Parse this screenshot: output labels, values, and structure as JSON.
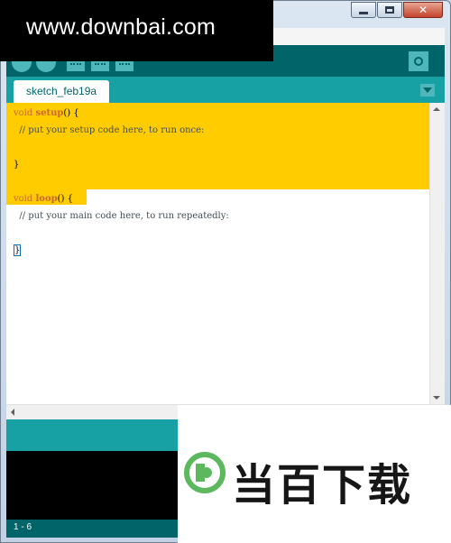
{
  "watermark": {
    "url_text": "www.downbai.com",
    "logo_text": "当百下载"
  },
  "tabs": [
    {
      "label": "sketch_feb19a"
    }
  ],
  "editor": {
    "setup_keyword": "void",
    "setup_name": "setup",
    "setup_parens": "() {",
    "setup_comment": "  // put your setup code here, to run once:",
    "close_brace": "}",
    "loop_keyword": "void",
    "loop_name": "loop",
    "loop_parens": "() {",
    "loop_comment": "  // put your main code here, to run repeatedly:",
    "loop_close_brace": "}"
  },
  "status": {
    "line_range": "1 - 6"
  },
  "colors": {
    "toolbar": "#006468",
    "tabbar": "#17a1a5",
    "highlight": "#ffcc00",
    "keyword": "#cc6633",
    "console": "#000000",
    "logo_green": "#5cb85c"
  }
}
